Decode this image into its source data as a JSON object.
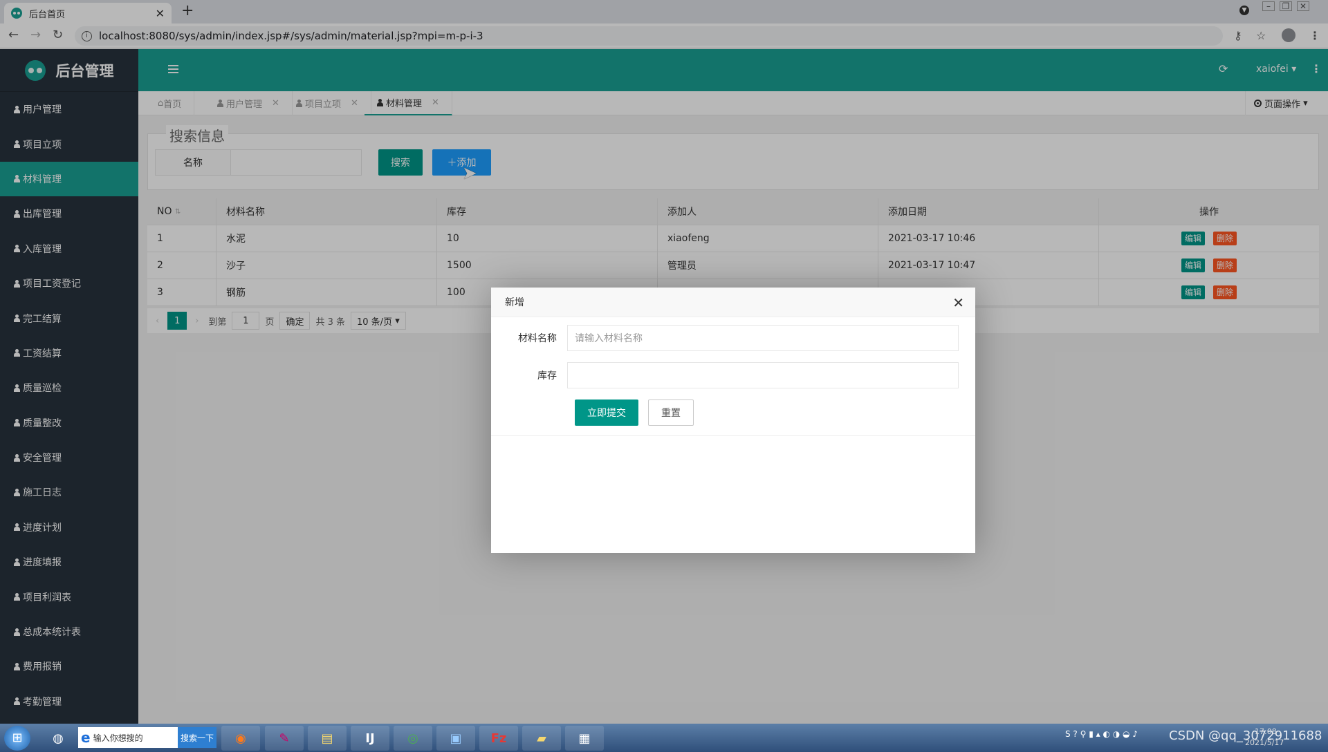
{
  "browser": {
    "tab_title": "后台首页",
    "new_tab": "+",
    "url": "localhost:8080/sys/admin/index.jsp#/sys/admin/material.jsp?mpi=m-p-i-3"
  },
  "app": {
    "logo_text": "后台管理",
    "user": "xaiofei",
    "page_ops": "页面操作"
  },
  "sidebar": {
    "items": [
      {
        "label": "用户管理"
      },
      {
        "label": "项目立项"
      },
      {
        "label": "材料管理"
      },
      {
        "label": "出库管理"
      },
      {
        "label": "入库管理"
      },
      {
        "label": "项目工资登记"
      },
      {
        "label": "完工结算"
      },
      {
        "label": "工资结算"
      },
      {
        "label": "质量巡检"
      },
      {
        "label": "质量整改"
      },
      {
        "label": "安全管理"
      },
      {
        "label": "施工日志"
      },
      {
        "label": "进度计划"
      },
      {
        "label": "进度填报"
      },
      {
        "label": "项目利润表"
      },
      {
        "label": "总成本统计表"
      },
      {
        "label": "费用报销"
      },
      {
        "label": "考勤管理"
      }
    ],
    "active_index": 2
  },
  "page_tabs": [
    {
      "label": "首页"
    },
    {
      "label": "用户管理"
    },
    {
      "label": "项目立项"
    },
    {
      "label": "材料管理"
    }
  ],
  "search": {
    "legend": "搜索信息",
    "name_label": "名称",
    "search_btn": "搜索",
    "add_btn": "添加"
  },
  "table": {
    "headers": [
      "NO",
      "材料名称",
      "库存",
      "添加人",
      "添加日期",
      "操作"
    ],
    "rows": [
      {
        "no": "1",
        "name": "水泥",
        "stock": "10",
        "adder": "xiaofeng",
        "date": "2021-03-17 10:46"
      },
      {
        "no": "2",
        "name": "沙子",
        "stock": "1500",
        "adder": "管理员",
        "date": "2021-03-17 10:47"
      },
      {
        "no": "3",
        "name": "钢筋",
        "stock": "100",
        "adder": "",
        "date": ""
      }
    ],
    "edit_label": "编辑",
    "delete_label": "删除"
  },
  "pager": {
    "current": "1",
    "goto_label": "到第",
    "page_input": "1",
    "page_unit": "页",
    "confirm": "确定",
    "total": "共 3 条",
    "page_size": "10 条/页"
  },
  "modal": {
    "title": "新增",
    "name_label": "材料名称",
    "name_placeholder": "请输入材料名称",
    "stock_label": "库存",
    "stock_value": "",
    "submit": "立即提交",
    "reset": "重置"
  },
  "taskbar": {
    "search_placeholder": "输入你想搜的",
    "search_button": "搜索一下",
    "watermark": "CSDN @qq_3072911688",
    "clock_time": "17:08",
    "clock_date": "2021/5/17"
  },
  "colors": {
    "primary": "#1aa094",
    "sidebar": "#28333e",
    "add_button": "#1e9fff",
    "danger": "#ff5722"
  }
}
